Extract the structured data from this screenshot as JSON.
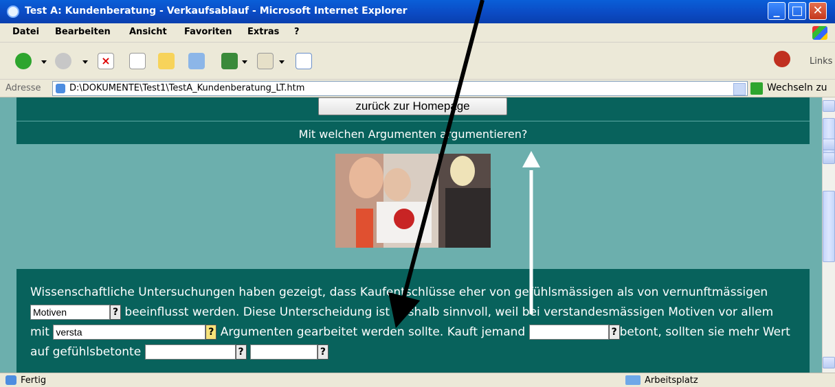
{
  "window": {
    "title": "Test A: Kundenberatung - Verkaufsablauf - Microsoft Internet Explorer"
  },
  "menu": {
    "items": [
      "Datei",
      "Bearbeiten",
      "Ansicht",
      "Favoriten",
      "Extras",
      "?"
    ]
  },
  "toolbar": {
    "links_label": "Links"
  },
  "address": {
    "label": "Adresse",
    "url": "D:\\DOKUMENTE\\Test1\\TestA_Kundenberatung_LT.htm",
    "go_label": "Wechseln zu"
  },
  "page": {
    "home_button": "zurück zur Homepage",
    "question": "Mit welchen Argumenten argumentieren?",
    "text": {
      "p1": "Wissenschaftliche Untersuchungen haben gezeigt, dass Kaufentschlüsse eher von gefühlsmässigen als von vernunftmässigen",
      "blank1": "Motiven",
      "p2": "beeinflusst werden. Diese Unterscheidung ist deshalb sinnvoll, weil bei verstandesmässigen Motiven vor allem mit",
      "blank2": "versta",
      "p3": "Argumenten gearbeitet werden sollte. Kauft jemand",
      "blank3": "",
      "p4": "betont, sollten sie mehr Wert auf gefühlsbetonte",
      "blank4": "",
      "blank5": ""
    },
    "help_label": "?"
  },
  "status": {
    "left": "Fertig",
    "zone": "Arbeitsplatz"
  },
  "colors": {
    "page_bg": "#6cafad",
    "panel": "#08625c",
    "titlebar": "#0b4bc4"
  }
}
